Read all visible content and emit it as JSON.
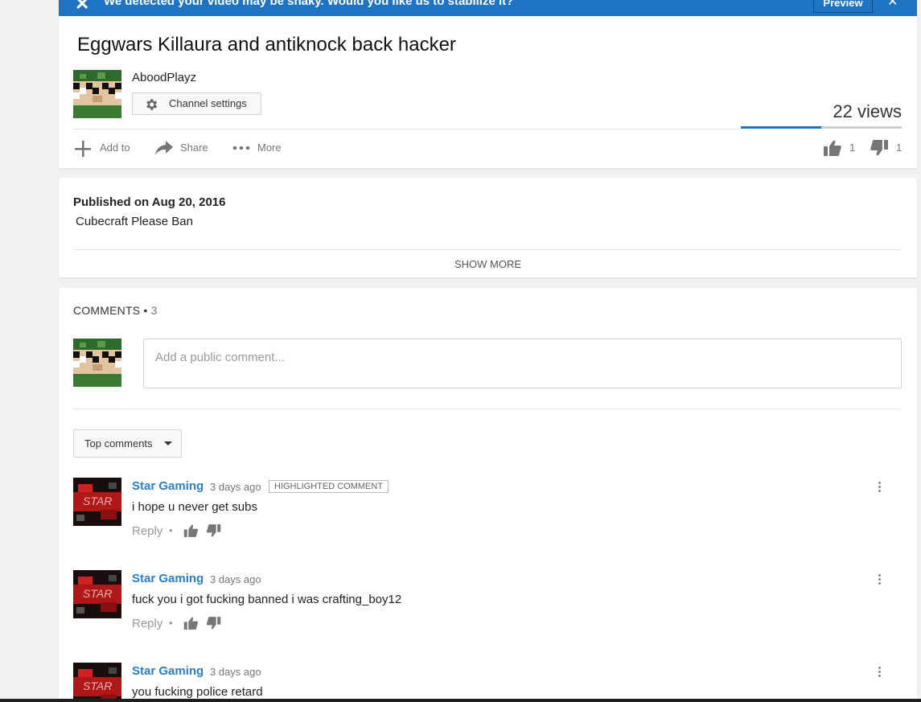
{
  "banner": {
    "message": "We detected your video may be shaky. Would you like us to stabilize it?",
    "preview_label": "Preview",
    "dismiss_icon": "close-icon",
    "close_icon": "close-icon"
  },
  "video": {
    "title": "Eggwars Killaura and antiknock back hacker",
    "channel_name": "AboodPlayz",
    "channel_settings_label": "Channel settings",
    "views": "22 views",
    "views_bar_fill_fraction": 0.5,
    "actions": {
      "add_to": "Add to",
      "share": "Share",
      "more": "More"
    },
    "likes": "1",
    "dislikes": "1"
  },
  "description": {
    "published": "Published on Aug 20, 2016",
    "text": "Cubecraft Please Ban",
    "show_more": "SHOW MORE"
  },
  "comments_section": {
    "header": "COMMENTS",
    "separator": "•",
    "count": "3",
    "input_placeholder": "Add a public comment...",
    "sort_label": "Top comments",
    "comments": [
      {
        "author": "Star Gaming",
        "time": "3 days ago",
        "badge": "HIGHLIGHTED COMMENT",
        "text": "i hope u never get subs",
        "reply_label": "Reply",
        "dot": "•"
      },
      {
        "author": "Star Gaming",
        "time": "3 days ago",
        "text": "fuck you i got fucking banned i was crafting_boy12",
        "reply_label": "Reply",
        "dot": "•"
      },
      {
        "author": "Star Gaming",
        "time": "3 days ago",
        "text": "you fucking police retard"
      }
    ]
  },
  "colors": {
    "accent_blue": "#1e73c3",
    "author_link": "#2a7ec6"
  }
}
